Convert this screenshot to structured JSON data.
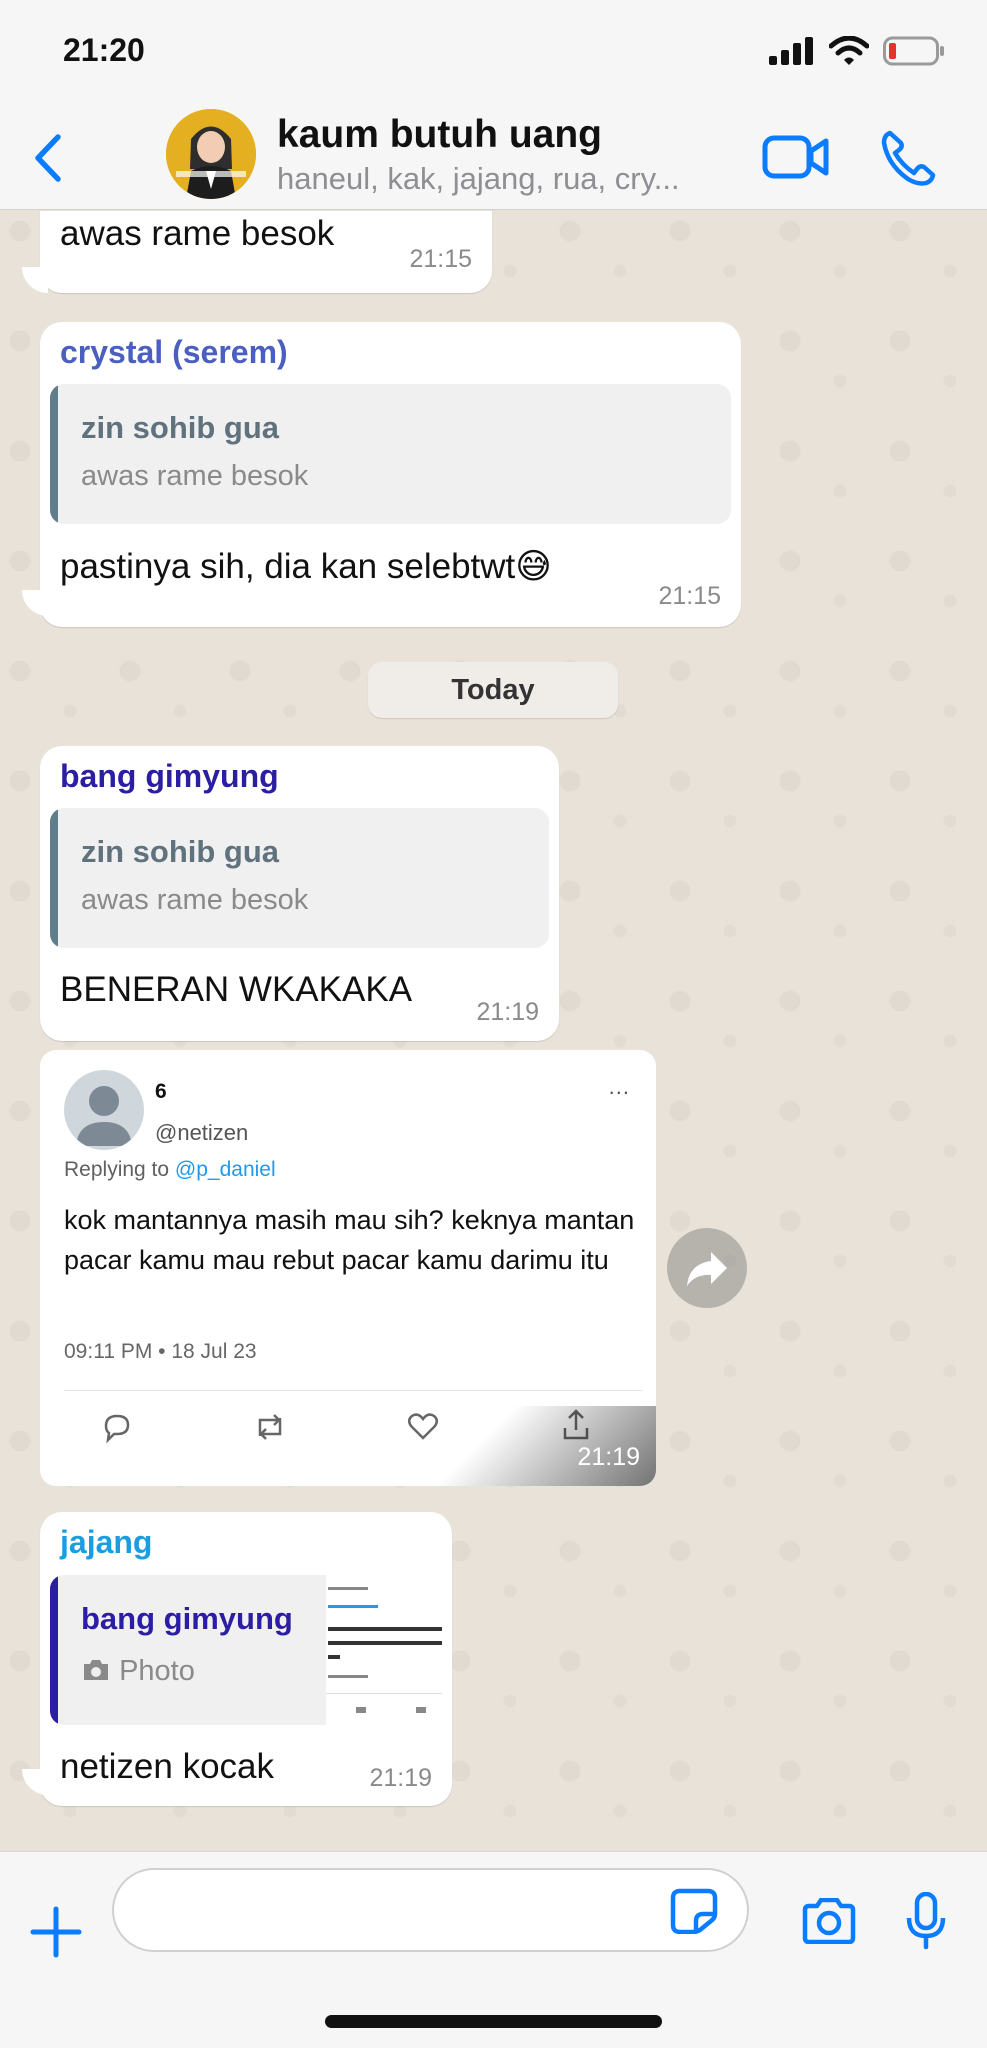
{
  "status_bar": {
    "time": "21:20"
  },
  "header": {
    "title": "kaum butuh uang",
    "members": "haneul, kak, jajang, rua, cry..."
  },
  "messages": [
    {
      "text": "awas rame besok",
      "time": "21:15"
    },
    {
      "sender": "crystal (serem)",
      "sender_color": "#4a5fbf",
      "quote": {
        "name": "zin sohib gua",
        "text": "awas rame besok",
        "bar_color": "#607d8b"
      },
      "text": "pastinya sih, dia kan selebtwt😅",
      "time": "21:15"
    },
    {
      "day_separator": "Today"
    },
    {
      "sender": "bang gimyung",
      "sender_color": "#2b1ea3",
      "quote": {
        "name": "zin sohib gua",
        "text": "awas rame besok",
        "bar_color": "#607d8b"
      },
      "text": "BENERAN WKAKAKA",
      "time": "21:19"
    },
    {
      "tweet": {
        "name": "6",
        "handle": "@netizen",
        "replying_label": "Replying to",
        "replying_to": "@p_daniel",
        "text": "kok mantannya masih mau sih? keknya mantan pacar kamu mau rebut pacar kamu darimu itu",
        "date": "09:11 PM  •  18 Jul 23",
        "more": "..."
      },
      "time": "21:19"
    },
    {
      "sender": "jajang",
      "sender_color": "#1a9ee0",
      "quote": {
        "name": "bang gimyung",
        "text": "Photo",
        "bar_color": "#2b1ea3",
        "name_color": "#2b1ea3"
      },
      "text": "netizen kocak",
      "time": "21:19"
    }
  ],
  "colors": {
    "ios_blue": "#0a7cff",
    "chat_background": "#e9e2d8",
    "bubble": "#ffffff"
  }
}
